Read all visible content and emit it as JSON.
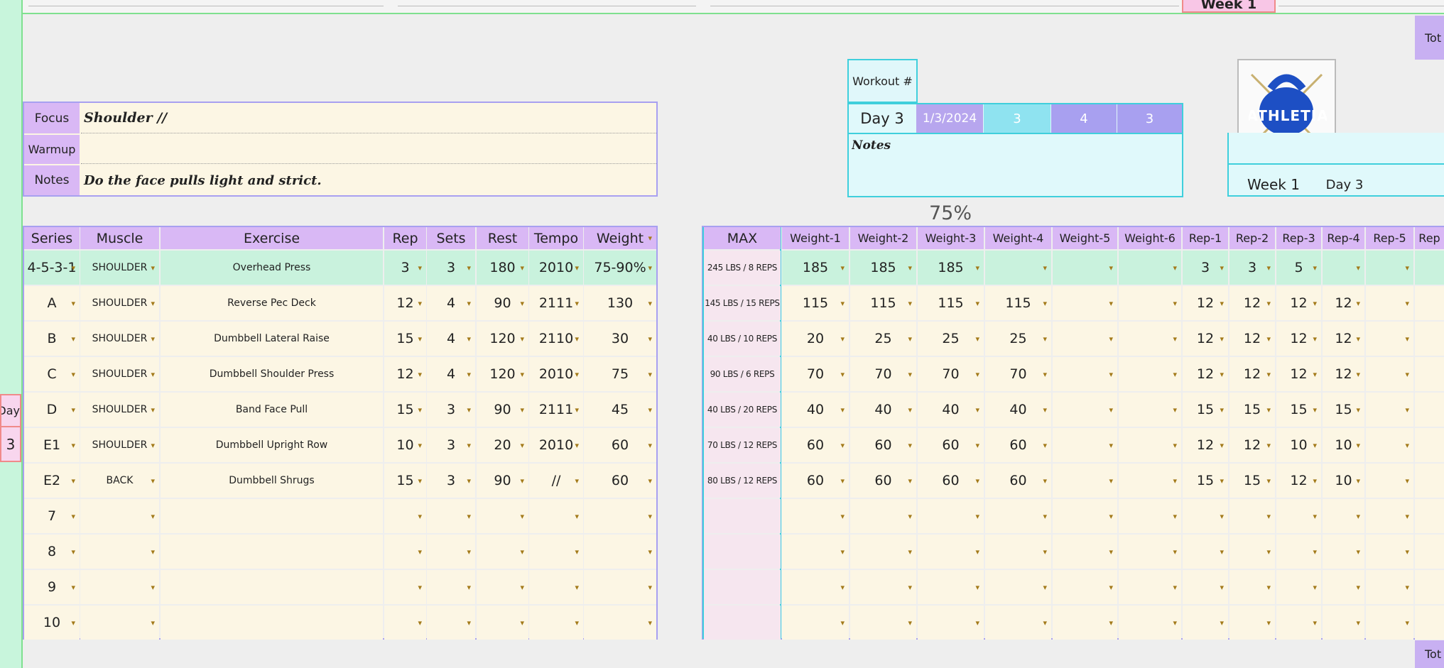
{
  "top": {
    "week_tab": "Week 1",
    "total_tab_top": "Tot",
    "total_tab_bottom": "Tot"
  },
  "side": {
    "day_label": "Day",
    "day_num": "3"
  },
  "info": {
    "focus_label": "Focus",
    "focus_value": "Shoulder //",
    "warmup_label": "Warmup",
    "warmup_value": "",
    "notes_label": "Notes",
    "notes_value": "Do the face pulls light and strict."
  },
  "workout": {
    "num_label": "Workout #",
    "day": "Day 3",
    "date": "1/3/2024",
    "v1": "3",
    "v2": "4",
    "v3": "3",
    "notes_label": "Notes",
    "percent": "75%"
  },
  "logo": {
    "text": "ATHLETIA",
    "week": "Week 1",
    "day": "Day 3"
  },
  "left_headers": {
    "series": "Series",
    "muscle": "Muscle",
    "exercise": "Exercise",
    "rep": "Rep",
    "sets": "Sets",
    "rest": "Rest",
    "tempo": "Tempo",
    "weight": "Weight"
  },
  "right_headers": {
    "max": "MAX",
    "weights": [
      "Weight-1",
      "Weight-2",
      "Weight-3",
      "Weight-4",
      "Weight-5",
      "Weight-6"
    ],
    "reps": [
      "Rep-1",
      "Rep-2",
      "Rep-3",
      "Rep-4",
      "Rep-5",
      "Rep"
    ]
  },
  "rows": [
    {
      "series": "4-5-3-1",
      "muscle": "SHOULDER",
      "exercise": "Overhead Press",
      "rep": "3",
      "sets": "3",
      "rest": "180",
      "tempo": "2010",
      "weight": "75-90%",
      "max": "245 LBS / 8 REPS",
      "w": [
        "185",
        "185",
        "185",
        "",
        "",
        ""
      ],
      "r": [
        "3",
        "3",
        "5",
        "",
        "",
        ""
      ]
    },
    {
      "series": "A",
      "muscle": "SHOULDER",
      "exercise": "Reverse Pec Deck",
      "rep": "12",
      "sets": "4",
      "rest": "90",
      "tempo": "2111",
      "weight": "130",
      "max": "145 LBS / 15 REPS",
      "w": [
        "115",
        "115",
        "115",
        "115",
        "",
        ""
      ],
      "r": [
        "12",
        "12",
        "12",
        "12",
        "",
        ""
      ]
    },
    {
      "series": "B",
      "muscle": "SHOULDER",
      "exercise": "Dumbbell Lateral Raise",
      "rep": "15",
      "sets": "4",
      "rest": "120",
      "tempo": "2110",
      "weight": "30",
      "max": "40 LBS / 10 REPS",
      "w": [
        "20",
        "25",
        "25",
        "25",
        "",
        ""
      ],
      "r": [
        "12",
        "12",
        "12",
        "12",
        "",
        ""
      ]
    },
    {
      "series": "C",
      "muscle": "SHOULDER",
      "exercise": "Dumbbell Shoulder Press",
      "rep": "12",
      "sets": "4",
      "rest": "120",
      "tempo": "2010",
      "weight": "75",
      "max": "90 LBS / 6 REPS",
      "w": [
        "70",
        "70",
        "70",
        "70",
        "",
        ""
      ],
      "r": [
        "12",
        "12",
        "12",
        "12",
        "",
        ""
      ]
    },
    {
      "series": "D",
      "muscle": "SHOULDER",
      "exercise": "Band Face Pull",
      "rep": "15",
      "sets": "3",
      "rest": "90",
      "tempo": "2111",
      "weight": "45",
      "max": "40 LBS / 20 REPS",
      "w": [
        "40",
        "40",
        "40",
        "40",
        "",
        ""
      ],
      "r": [
        "15",
        "15",
        "15",
        "15",
        "",
        ""
      ]
    },
    {
      "series": "E1",
      "muscle": "SHOULDER",
      "exercise": "Dumbbell Upright Row",
      "rep": "10",
      "sets": "3",
      "rest": "20",
      "tempo": "2010",
      "weight": "60",
      "max": "70 LBS / 12 REPS",
      "w": [
        "60",
        "60",
        "60",
        "60",
        "",
        ""
      ],
      "r": [
        "12",
        "12",
        "10",
        "10",
        "",
        ""
      ]
    },
    {
      "series": "E2",
      "muscle": "BACK",
      "exercise": "Dumbbell Shrugs",
      "rep": "15",
      "sets": "3",
      "rest": "90",
      "tempo": "//",
      "weight": "60",
      "max": "80 LBS / 12 REPS",
      "w": [
        "60",
        "60",
        "60",
        "60",
        "",
        ""
      ],
      "r": [
        "15",
        "15",
        "12",
        "10",
        "",
        ""
      ]
    },
    {
      "series": "7",
      "muscle": "",
      "exercise": "",
      "rep": "",
      "sets": "",
      "rest": "",
      "tempo": "",
      "weight": "",
      "max": "",
      "w": [
        "",
        "",
        "",
        "",
        "",
        ""
      ],
      "r": [
        "",
        "",
        "",
        "",
        "",
        ""
      ]
    },
    {
      "series": "8",
      "muscle": "",
      "exercise": "",
      "rep": "",
      "sets": "",
      "rest": "",
      "tempo": "",
      "weight": "",
      "max": "",
      "w": [
        "",
        "",
        "",
        "",
        "",
        ""
      ],
      "r": [
        "",
        "",
        "",
        "",
        "",
        ""
      ]
    },
    {
      "series": "9",
      "muscle": "",
      "exercise": "",
      "rep": "",
      "sets": "",
      "rest": "",
      "tempo": "",
      "weight": "",
      "max": "",
      "w": [
        "",
        "",
        "",
        "",
        "",
        ""
      ],
      "r": [
        "",
        "",
        "",
        "",
        "",
        ""
      ]
    },
    {
      "series": "10",
      "muscle": "",
      "exercise": "",
      "rep": "",
      "sets": "",
      "rest": "",
      "tempo": "",
      "weight": "",
      "max": "",
      "w": [
        "",
        "",
        "",
        "",
        "",
        ""
      ],
      "r": [
        "",
        "",
        "",
        "",
        "",
        ""
      ]
    }
  ],
  "colors": {
    "header": "#d9b8f5",
    "cream": "#fcf6e4",
    "mint": "#c9f2dd",
    "pink": "#f6e6ef",
    "cyan": "#3fcfdc",
    "lavender": "#a8a0f0"
  }
}
